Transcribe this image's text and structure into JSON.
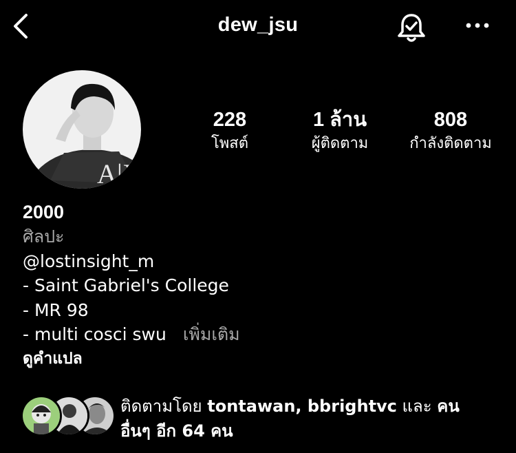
{
  "header": {
    "username": "dew_jsu",
    "back_icon": "chevron-left-icon",
    "bell_icon": "bell-check-icon",
    "more_icon": "more-horizontal-icon"
  },
  "stats": {
    "posts": {
      "value": "228",
      "label": "โพสต์"
    },
    "followers": {
      "value": "1 ล้าน",
      "label": "ผู้ติดตาม"
    },
    "following": {
      "value": "808",
      "label": "กำลังติดตาม"
    }
  },
  "bio": {
    "name": "2000",
    "category": "ศิลปะ",
    "mention": "@lostinsight_m",
    "lines": [
      "- Saint Gabriel's College",
      "- MR 98",
      "- multi cosci swu"
    ],
    "more_label": "เพิ่มเติม",
    "translate_label": "ดูคำแปล"
  },
  "followed_by": {
    "prefix": "ติดตามโดย",
    "names": "tontawan, bbrightvc",
    "joiner": "และ",
    "others_bold": "คน",
    "others_line2": "อื่นๆ อีก 64 คน"
  },
  "colors": {
    "background": "#000000",
    "text": "#ffffff",
    "secondary_text": "#a8a8a8"
  }
}
